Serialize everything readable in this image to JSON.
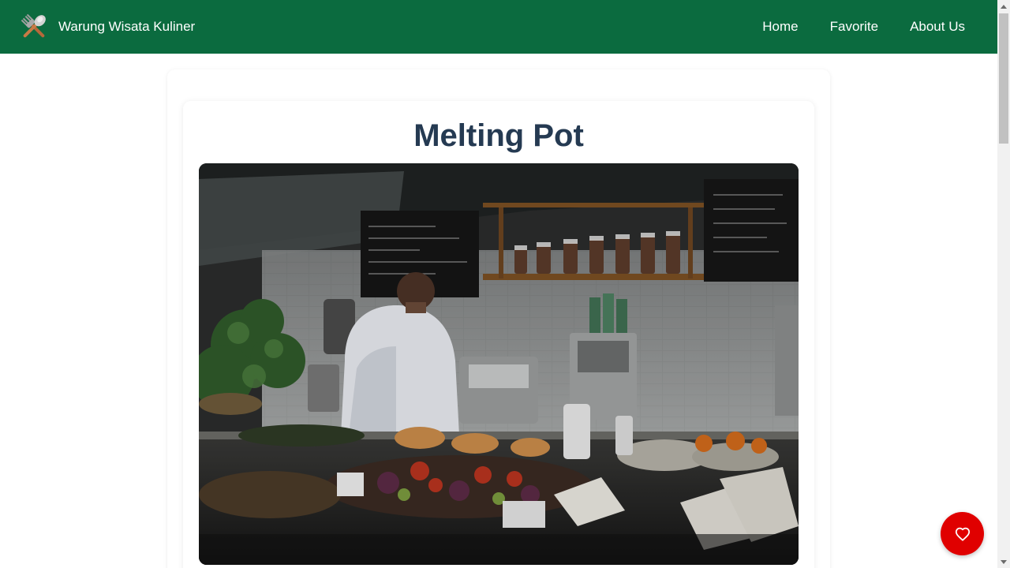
{
  "header": {
    "brand_name": "Warung Wisata Kuliner",
    "logo_icon": "fork-spoon-icon",
    "nav": [
      {
        "label": "Home"
      },
      {
        "label": "Favorite"
      },
      {
        "label": "About Us"
      }
    ],
    "background_color": "#0b6b3f"
  },
  "restaurant": {
    "name": "Melting Pot",
    "image_alt": "Melting Pot"
  },
  "favorite_button": {
    "icon": "heart-icon",
    "color": "#e00000"
  }
}
